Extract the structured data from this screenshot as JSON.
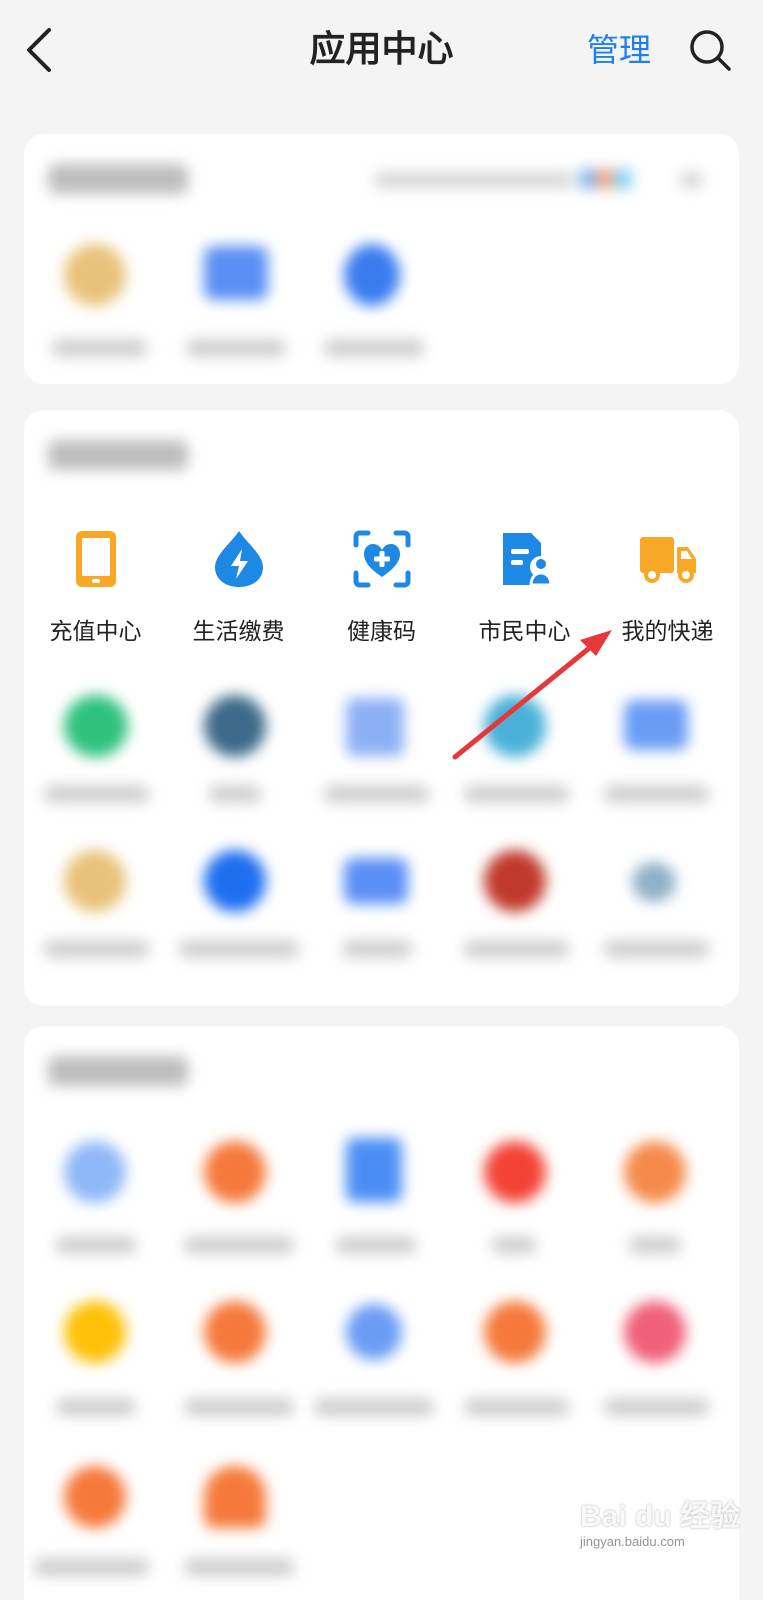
{
  "header": {
    "title": "应用中心",
    "manage_label": "管理"
  },
  "icons": {
    "back": "chevron-left-icon",
    "search": "search-icon"
  },
  "colors": {
    "accent": "#1d7ff2",
    "orange": "#f9a825",
    "blue": "#1e88e5",
    "arrow": "#e5383b"
  },
  "apps": [
    {
      "label": "充值中心",
      "icon": "tablet-icon"
    },
    {
      "label": "生活缴费",
      "icon": "lightning-drop-icon"
    },
    {
      "label": "健康码",
      "icon": "health-heart-scan-icon"
    },
    {
      "label": "市民中心",
      "icon": "citizen-document-icon"
    },
    {
      "label": "我的快递",
      "icon": "delivery-truck-icon"
    }
  ],
  "watermark": {
    "main": "Bai du 经验",
    "sub": "jingyan.baidu.com"
  }
}
